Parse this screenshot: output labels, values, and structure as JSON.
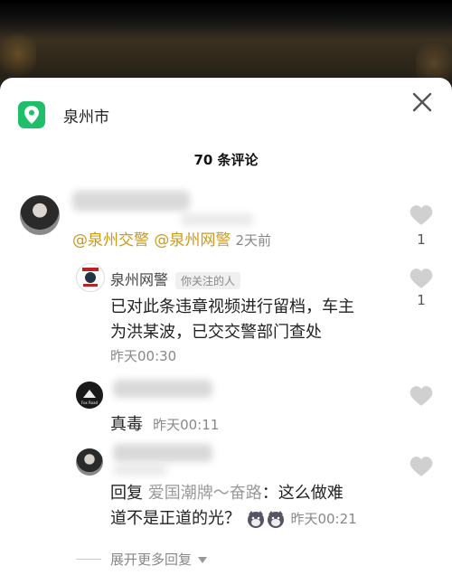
{
  "location": {
    "city": "泉州市"
  },
  "header": {
    "title": "70 条评论"
  },
  "comments": [
    {
      "mentions": "@泉州交警 @泉州网警",
      "time": "2天前",
      "likes": "1"
    },
    {
      "name": "泉州网警",
      "tag": "你关注的人",
      "text_line1": "已对此条违章视频进行留档，车主",
      "text_line2": "为洪某波，已交交警部门查处",
      "time": "昨天00:30",
      "likes": "1"
    },
    {
      "text": "真毒",
      "time": "昨天00:11"
    },
    {
      "reply_prefix": "回复",
      "reply_to": "爱国潮牌～奋路",
      "text_a": "：这么做难",
      "text_b": "道不是正道的光？",
      "time": "昨天00:21"
    }
  ],
  "footer": {
    "more_label": "展开更多回复"
  },
  "colors": {
    "accent_green": "#1fbf6a",
    "mention": "#c99a1a"
  }
}
